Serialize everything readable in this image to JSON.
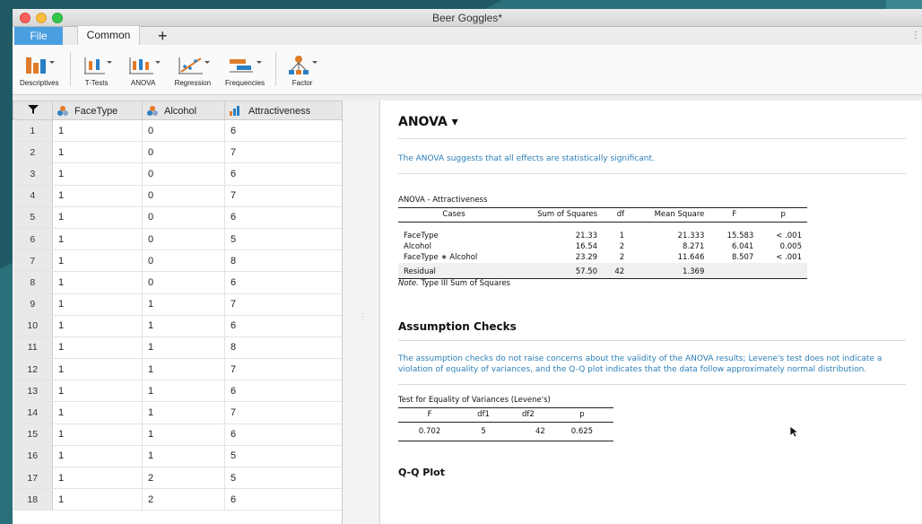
{
  "window": {
    "title": "Beer Goggles*"
  },
  "tabs": {
    "file": "File",
    "common": "Common",
    "add": "+",
    "more": "⋮"
  },
  "ribbon": [
    {
      "name": "descriptives",
      "label": "Descriptives",
      "icon": "descriptives-icon"
    },
    {
      "name": "t-tests",
      "label": "T-Tests",
      "icon": "t-tests-icon"
    },
    {
      "name": "anova",
      "label": "ANOVA",
      "icon": "anova-icon"
    },
    {
      "name": "regression",
      "label": "Regression",
      "icon": "regression-icon"
    },
    {
      "name": "frequencies",
      "label": "Frequencies",
      "icon": "frequencies-icon"
    },
    {
      "name": "factor",
      "label": "Factor",
      "icon": "factor-icon"
    }
  ],
  "grid": {
    "columns": [
      "FaceType",
      "Alcohol",
      "Attractiveness"
    ],
    "rows": [
      [
        "1",
        "1",
        "0",
        "6"
      ],
      [
        "2",
        "1",
        "0",
        "7"
      ],
      [
        "3",
        "1",
        "0",
        "6"
      ],
      [
        "4",
        "1",
        "0",
        "7"
      ],
      [
        "5",
        "1",
        "0",
        "6"
      ],
      [
        "6",
        "1",
        "0",
        "5"
      ],
      [
        "7",
        "1",
        "0",
        "8"
      ],
      [
        "8",
        "1",
        "0",
        "6"
      ],
      [
        "9",
        "1",
        "1",
        "7"
      ],
      [
        "10",
        "1",
        "1",
        "6"
      ],
      [
        "11",
        "1",
        "1",
        "8"
      ],
      [
        "12",
        "1",
        "1",
        "7"
      ],
      [
        "13",
        "1",
        "1",
        "6"
      ],
      [
        "14",
        "1",
        "1",
        "7"
      ],
      [
        "15",
        "1",
        "1",
        "6"
      ],
      [
        "16",
        "1",
        "1",
        "5"
      ],
      [
        "17",
        "1",
        "2",
        "5"
      ],
      [
        "18",
        "1",
        "2",
        "6"
      ]
    ]
  },
  "results": {
    "heading": "ANOVA ▾",
    "summary": "The ANOVA suggests that all effects are statistically significant.",
    "anova_table": {
      "title": "ANOVA - Attractiveness",
      "headers": [
        "Cases",
        "Sum of Squares",
        "df",
        "Mean Square",
        "F",
        "p"
      ],
      "rows": [
        [
          "FaceType",
          "21.33",
          "1",
          "21.333",
          "15.583",
          "< .001"
        ],
        [
          "Alcohol",
          "16.54",
          "2",
          "8.271",
          "6.041",
          "0.005"
        ],
        [
          "FaceType ∗ Alcohol",
          "23.29",
          "2",
          "11.646",
          "8.507",
          "< .001"
        ]
      ],
      "residual": [
        "Residual",
        "57.50",
        "42",
        "1.369",
        "",
        ""
      ],
      "note_italic": "Note.",
      "note": " Type III Sum of Squares"
    },
    "assumption_heading": "Assumption Checks",
    "assumption_text": "The assumption checks do not raise concerns about the validity of the ANOVA results; Levene's test does not indicate a violation of equality of variances, and the Q-Q plot indicates that the data follow approximately normal distribution.",
    "levene_table": {
      "title": "Test for Equality of Variances (Levene's)",
      "headers": [
        "F",
        "df1",
        "df2",
        "p"
      ],
      "row": [
        "0.702",
        "5",
        "42",
        "0.625"
      ]
    },
    "qq_heading": "Q-Q Plot"
  },
  "colors": {
    "file_tab": "#4a9fe0",
    "result_blue": "#2c7fb8"
  }
}
